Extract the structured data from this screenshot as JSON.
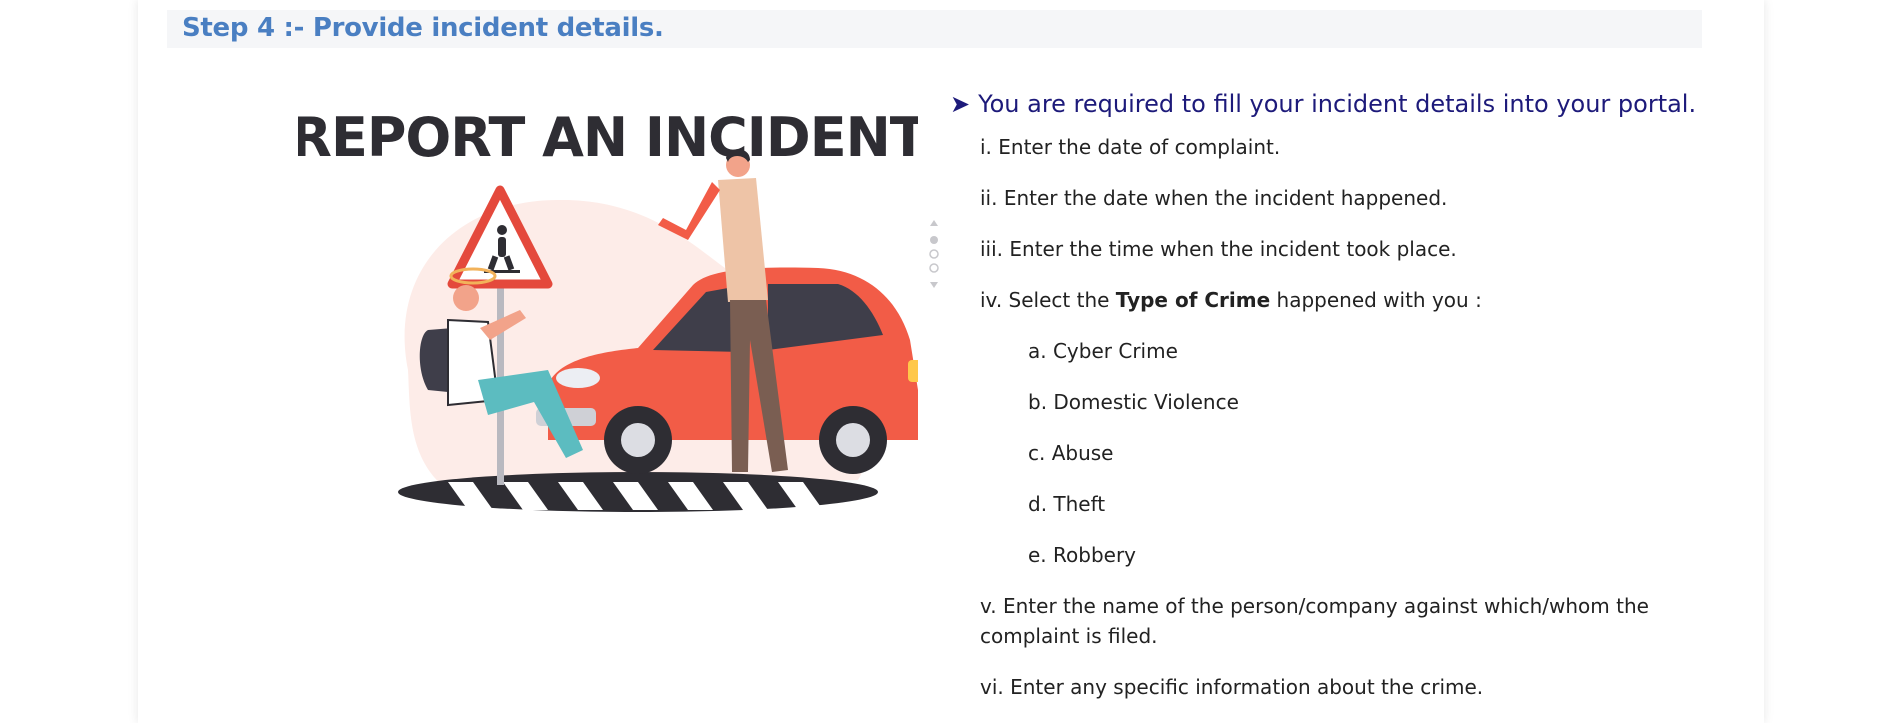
{
  "step": {
    "title": "Step 4 :- Provide incident details."
  },
  "illustration": {
    "heading": "REPORT AN INCIDENT",
    "colors": {
      "car": "#f25c47",
      "sign": "#e4493c",
      "heading": "#2e2d33",
      "blob": "#fdece8",
      "pants": "#7a5e52",
      "jeans": "#5cbcc0"
    }
  },
  "content": {
    "arrow_icon": "arrow-right-icon",
    "lead": "You are required to fill your incident details into your portal.",
    "items": [
      "i. Enter the date of complaint.",
      "ii. Enter the date when the incident happened.",
      "iii. Enter the time when the incident took place."
    ],
    "crime": {
      "prefix": "iv. Select the ",
      "bold": "Type of Crime",
      "suffix": " happened with you :"
    },
    "crime_types": [
      "a. Cyber Crime",
      "b. Domestic Violence",
      "c. Abuse",
      "d. Theft",
      "e. Robbery"
    ],
    "item_v_line1": "v. Enter the name of the person/company against which/whom the",
    "item_v_line2": "complaint is filed.",
    "item_vi": "vi. Enter any specific information about the crime."
  }
}
